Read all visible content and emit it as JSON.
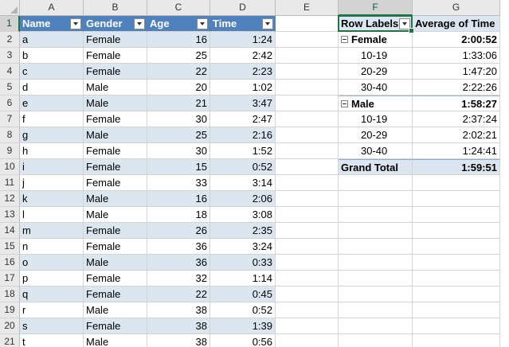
{
  "columns": [
    "A",
    "B",
    "C",
    "D",
    "E",
    "F",
    "G"
  ],
  "active_column": "F",
  "active_row": 1,
  "table": {
    "headers": [
      "Name",
      "Gender",
      "Age",
      "Time"
    ],
    "rows": [
      [
        "a",
        "Female",
        "16",
        "1:24"
      ],
      [
        "b",
        "Female",
        "25",
        "2:42"
      ],
      [
        "c",
        "Female",
        "22",
        "2:23"
      ],
      [
        "d",
        "Male",
        "20",
        "1:02"
      ],
      [
        "e",
        "Male",
        "21",
        "3:47"
      ],
      [
        "f",
        "Female",
        "30",
        "2:47"
      ],
      [
        "g",
        "Male",
        "25",
        "2:16"
      ],
      [
        "h",
        "Female",
        "30",
        "1:52"
      ],
      [
        "i",
        "Female",
        "15",
        "0:52"
      ],
      [
        "j",
        "Female",
        "33",
        "3:14"
      ],
      [
        "k",
        "Male",
        "16",
        "2:06"
      ],
      [
        "l",
        "Male",
        "18",
        "3:08"
      ],
      [
        "m",
        "Female",
        "26",
        "2:35"
      ],
      [
        "n",
        "Female",
        "36",
        "3:24"
      ],
      [
        "o",
        "Male",
        "36",
        "0:33"
      ],
      [
        "p",
        "Female",
        "32",
        "1:14"
      ],
      [
        "q",
        "Female",
        "22",
        "0:45"
      ],
      [
        "r",
        "Male",
        "38",
        "0:52"
      ],
      [
        "s",
        "Female",
        "38",
        "1:39"
      ],
      [
        "t",
        "Male",
        "38",
        "0:56"
      ]
    ]
  },
  "pivot": {
    "header_labels": "Row Labels",
    "header_values": "Average of Time",
    "groups": [
      {
        "label": "Female",
        "value": "2:00:52",
        "items": [
          {
            "label": "10-19",
            "value": "1:33:06"
          },
          {
            "label": "20-29",
            "value": "1:47:20"
          },
          {
            "label": "30-40",
            "value": "2:22:26"
          }
        ]
      },
      {
        "label": "Male",
        "value": "1:58:27",
        "items": [
          {
            "label": "10-19",
            "value": "2:37:24"
          },
          {
            "label": "20-29",
            "value": "2:02:21"
          },
          {
            "label": "30-40",
            "value": "1:24:41"
          }
        ]
      }
    ],
    "grand_total_label": "Grand Total",
    "grand_total_value": "1:59:51"
  }
}
